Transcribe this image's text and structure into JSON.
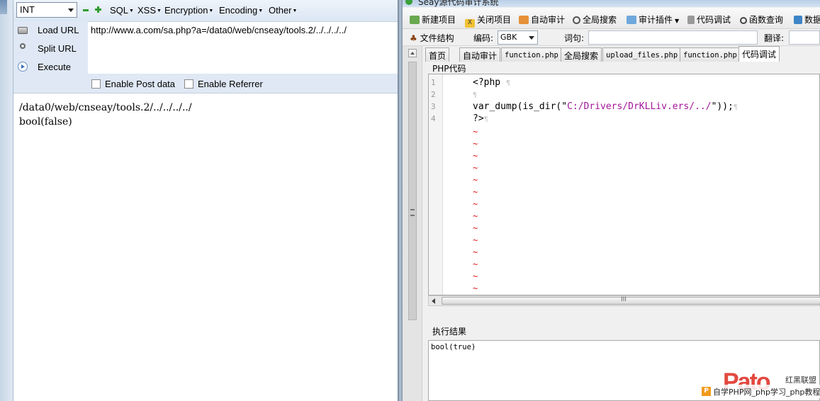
{
  "hackbar": {
    "select_value": "INT",
    "menus": [
      "SQL",
      "XSS",
      "Encryption",
      "Encoding",
      "Other"
    ],
    "actions": {
      "load": "Load URL",
      "split": "Split URL",
      "execute": "Execute"
    },
    "url": "http://www.a.com/sa.php?a=/data0/web/cnseay/tools.2/../../../../",
    "options": {
      "post": "Enable Post data",
      "referrer": "Enable Referrer"
    },
    "output": [
      "/data0/web/cnseay/tools.2/../../../../",
      "bool(false)"
    ]
  },
  "seay": {
    "title": "Seay源代码审计系统",
    "toolbar": {
      "new_project": "新建项目",
      "close_project": "关闭项目",
      "auto_audit": "自动审计",
      "global_search": "全局搜索",
      "audit_plugin": "审计插件",
      "code_debug": "代码调试",
      "func_query": "函数查询",
      "data": "数据"
    },
    "toolbar2": {
      "file_structure": "文件结构",
      "encoding_label": "编码:",
      "encoding_value": "GBK",
      "query_label": "词句:",
      "translate_label": "翻译:"
    },
    "tabs": [
      "首页",
      "自动审计",
      "function.php",
      "全局搜索",
      "upload_files.php",
      "function.php",
      "代码调试"
    ],
    "active_tab": "代码调试",
    "code_label": "PHP代码",
    "code": {
      "line_numbers": [
        "1",
        "2",
        "3",
        "4"
      ],
      "line1": "<?php",
      "line3_pre": "var_dump(is_dir(\"",
      "line3_str": "C:/Drivers/DrKLLiv.ers/../",
      "line3_post": "\"));",
      "line4": "?>",
      "para_mark": "¶",
      "empty_marker": "~"
    },
    "scroll_grip": "III",
    "result_label": "执行结果",
    "result_value": "bool(true)"
  },
  "watermark": {
    "logo": "Pato",
    "brand": "红黑联盟",
    "bar_icon": "P",
    "bar_text": "自学PHP网_php学习_php教程"
  },
  "colors": {
    "string": "#a31599",
    "tilde": "#dd1111",
    "hackbar_bg": "#dfe8f4"
  }
}
